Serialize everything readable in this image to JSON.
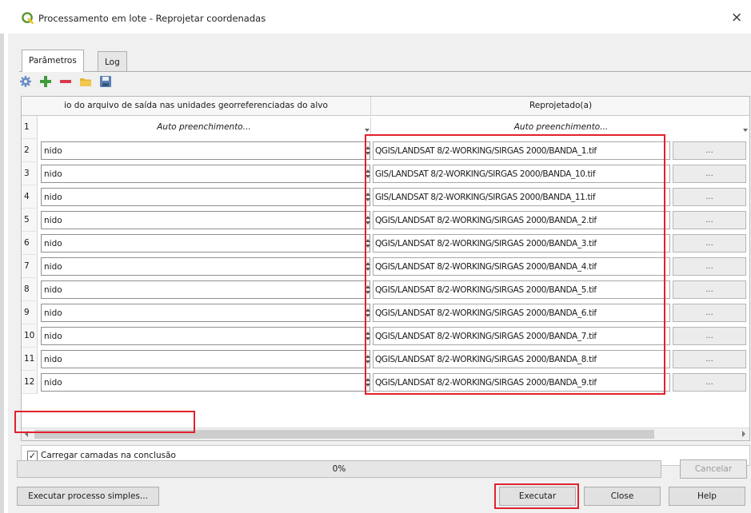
{
  "window": {
    "title": "Processamento em lote - Reprojetar coordenadas",
    "close_glyph": "×",
    "app_icon": "qgis-logo-icon"
  },
  "tabs": [
    {
      "label": "Parâmetros",
      "active": true
    },
    {
      "label": "Log",
      "active": false
    }
  ],
  "toolbar": {
    "icons": [
      "gear-icon",
      "add-row-icon",
      "remove-row-icon",
      "open-folder-icon",
      "save-icon"
    ]
  },
  "table": {
    "columns": [
      "io do arquivo de saída nas unidades georreferenciadas do alvo",
      "Reprojetado(a)"
    ],
    "autofill_row": {
      "number": "1",
      "col1": "Auto preenchimento...",
      "col2": "Auto preenchimento..."
    },
    "rows": [
      {
        "num": "2",
        "value": "nido",
        "path": "QGIS/LANDSAT 8/2-WORKING/SIRGAS 2000/BANDA_1.tif",
        "browse": "..."
      },
      {
        "num": "3",
        "value": "nido",
        "path": "GIS/LANDSAT 8/2-WORKING/SIRGAS 2000/BANDA_10.tif",
        "browse": "..."
      },
      {
        "num": "4",
        "value": "nido",
        "path": "GIS/LANDSAT 8/2-WORKING/SIRGAS 2000/BANDA_11.tif",
        "browse": "..."
      },
      {
        "num": "5",
        "value": "nido",
        "path": "QGIS/LANDSAT 8/2-WORKING/SIRGAS 2000/BANDA_2.tif",
        "browse": "..."
      },
      {
        "num": "6",
        "value": "nido",
        "path": "QGIS/LANDSAT 8/2-WORKING/SIRGAS 2000/BANDA_3.tif",
        "browse": "..."
      },
      {
        "num": "7",
        "value": "nido",
        "path": "QGIS/LANDSAT 8/2-WORKING/SIRGAS 2000/BANDA_4.tif",
        "browse": "..."
      },
      {
        "num": "8",
        "value": "nido",
        "path": "QGIS/LANDSAT 8/2-WORKING/SIRGAS 2000/BANDA_5.tif",
        "browse": "..."
      },
      {
        "num": "9",
        "value": "nido",
        "path": "QGIS/LANDSAT 8/2-WORKING/SIRGAS 2000/BANDA_6.tif",
        "browse": "..."
      },
      {
        "num": "10",
        "value": "nido",
        "path": "QGIS/LANDSAT 8/2-WORKING/SIRGAS 2000/BANDA_7.tif",
        "browse": "..."
      },
      {
        "num": "11",
        "value": "nido",
        "path": "QGIS/LANDSAT 8/2-WORKING/SIRGAS 2000/BANDA_8.tif",
        "browse": "..."
      },
      {
        "num": "12",
        "value": "nido",
        "path": "QGIS/LANDSAT 8/2-WORKING/SIRGAS 2000/BANDA_9.tif",
        "browse": "..."
      }
    ]
  },
  "load_layers": {
    "label": "Carregar camadas na conclusão",
    "checked": true,
    "check_glyph": "✓"
  },
  "progress": {
    "value": 0,
    "label": "0%"
  },
  "buttons": {
    "cancel": "Cancelar",
    "run_single": "Executar processo simples...",
    "run": "Executar",
    "close": "Close",
    "help": "Help"
  },
  "colors": {
    "highlight": "#e0222c",
    "qgis_green": "#589632",
    "qgis_yellow": "#f0c62c"
  }
}
